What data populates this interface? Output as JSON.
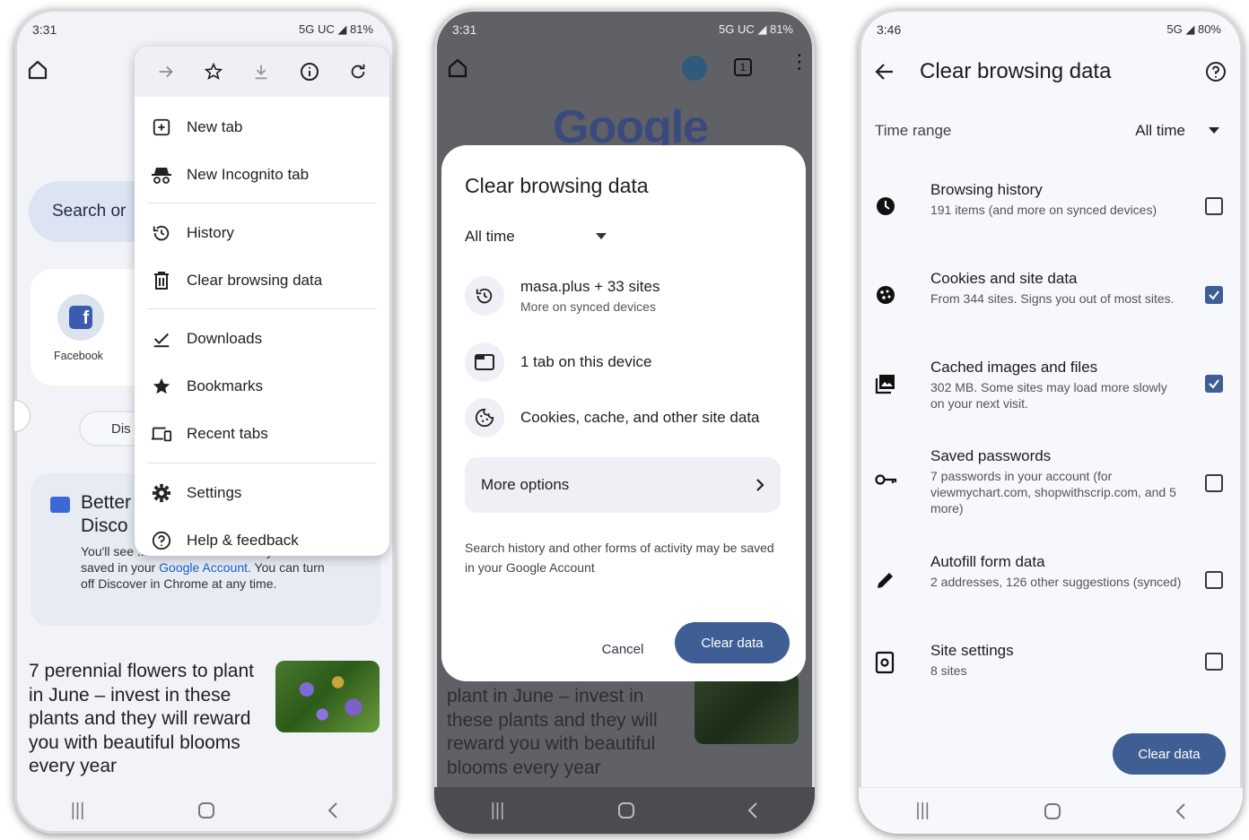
{
  "phone1": {
    "status": {
      "time": "3:31",
      "right": "5G UC ◢ 81%"
    },
    "search_placeholder": "Search or",
    "shortcut_label": "Facebook",
    "discover_button": "Dis",
    "card": {
      "title": "Better Disco",
      "body_before_link": "You'll see ... interests. Your activity here is saved in your ",
      "link": "Google Account",
      "body_after_link": ". You can turn off Discover in Chrome at any time."
    },
    "article": "7 perennial flowers to plant in June – invest in these plants and they will reward you with beautiful blooms every year",
    "menu": {
      "top_icons": [
        "forward-icon",
        "star-icon",
        "download-icon",
        "info-icon",
        "refresh-icon"
      ],
      "items": [
        {
          "label": "New tab",
          "icon": "new-tab-icon"
        },
        {
          "label": "New Incognito tab",
          "icon": "incognito-icon"
        },
        {
          "label": "History",
          "icon": "history-icon"
        },
        {
          "label": "Clear browsing data",
          "icon": "trash-icon"
        },
        {
          "label": "Downloads",
          "icon": "downloads-icon"
        },
        {
          "label": "Bookmarks",
          "icon": "bookmarks-star-icon"
        },
        {
          "label": "Recent tabs",
          "icon": "devices-icon"
        },
        {
          "label": "Settings",
          "icon": "gear-icon"
        },
        {
          "label": "Help & feedback",
          "icon": "help-icon"
        }
      ]
    }
  },
  "phone2": {
    "status": {
      "time": "3:31",
      "right": "5G UC ◢ 81%"
    },
    "tab_count": "1",
    "logo": "Google",
    "bg_article": "plant in June – invest in these plants and they will reward you with beautiful blooms every year",
    "dialog": {
      "title": "Clear browsing data",
      "time_range": "All time",
      "rows": [
        {
          "main": "masa.plus + 33 sites",
          "sub": "More on synced devices"
        },
        {
          "main": "1 tab on this device",
          "sub": ""
        },
        {
          "main": "Cookies, cache, and other site data",
          "sub": ""
        }
      ],
      "more_options": "More options",
      "note": "Search history and other forms of activity may be saved in your Google Account",
      "cancel": "Cancel",
      "clear": "Clear data"
    }
  },
  "phone3": {
    "status": {
      "time": "3:46",
      "right": "5G ◢ 80%"
    },
    "title": "Clear browsing data",
    "time_range_label": "Time range",
    "time_range_value": "All time",
    "options": [
      {
        "name": "Browsing history",
        "desc": "191 items (and more on synced devices)",
        "checked": false
      },
      {
        "name": "Cookies and site data",
        "desc": "From 344 sites. Signs you out of most sites.",
        "checked": true
      },
      {
        "name": "Cached images and files",
        "desc": "302 MB. Some sites may load more slowly on your next visit.",
        "checked": true
      },
      {
        "name": "Saved passwords",
        "desc": "7 passwords in your account (for viewmychart.com, shopwithscrip.com, and 5 more)",
        "checked": false
      },
      {
        "name": "Autofill form data",
        "desc": "2 addresses, 126 other suggestions (synced)",
        "checked": false
      },
      {
        "name": "Site settings",
        "desc": "8 sites",
        "checked": false
      }
    ],
    "clear_button": "Clear data"
  },
  "colors": {
    "primary_button": "#3f5e94",
    "checkbox_checked": "#3e5f95",
    "link": "#1a5ad0"
  }
}
